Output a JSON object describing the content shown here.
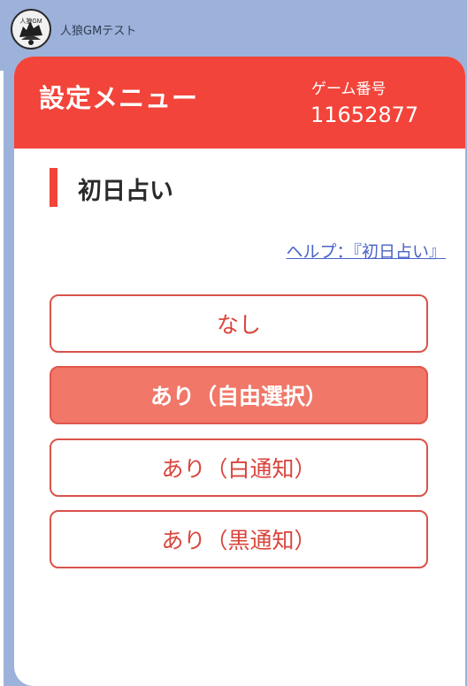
{
  "chat": {
    "sender_name": "人狼GMテスト",
    "avatar_text": "人狼GM"
  },
  "card": {
    "menu_title": "設定メニュー",
    "game_number_label": "ゲーム番号",
    "game_number": "11652877",
    "section_title": "初日占い",
    "help_link": "ヘルプ：『初日占い』",
    "options": [
      {
        "label": "なし",
        "selected": false
      },
      {
        "label": "あり（自由選択）",
        "selected": true
      },
      {
        "label": "あり（白通知）",
        "selected": false
      },
      {
        "label": "あり（黒通知）",
        "selected": false
      }
    ]
  },
  "colors": {
    "header": "#f2443a",
    "selected_option": "#f17768",
    "option_text": "#d9443c",
    "background": "#9db2da",
    "link": "#4a63c8"
  }
}
